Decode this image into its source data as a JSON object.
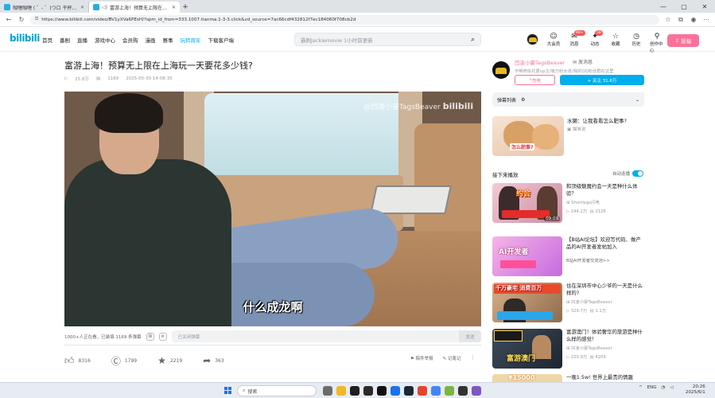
{
  "browser": {
    "tabs": [
      {
        "label": "咖喱咖喱 ( ゜- ゜)つロ 干杯~-bilibili",
        "active": false
      },
      {
        "label": "富游上海！预算无上限在上海...",
        "active": true
      }
    ],
    "new_tab": "+",
    "window_controls": {
      "minimize": "—",
      "maximize": "▢",
      "close": "✕"
    },
    "url": "https://www.bilibili.com/video/BV1yXVa6PEsH/?spm_id_from=333.1007.tianma.1-3-3.click&vd_source=7ac66cdf432812f7ec184060f708cb2d"
  },
  "site_header": {
    "logo": "bilibili",
    "nav": [
      "首页",
      "番剧",
      "直播",
      "游戏中心",
      "会员购",
      "漫画",
      "赛事",
      "玩转周年",
      "下载客户端"
    ],
    "search_placeholder": "霸刷Jackiemovie 1小时前更新",
    "user_icons": [
      {
        "label": "大会员",
        "glyph": "☺",
        "badge": ""
      },
      {
        "label": "消息",
        "glyph": "✉",
        "badge": "99+"
      },
      {
        "label": "动态",
        "glyph": "✦",
        "badge": "58"
      },
      {
        "label": "收藏",
        "glyph": "☆",
        "badge": ""
      },
      {
        "label": "历史",
        "glyph": "◷",
        "badge": ""
      },
      {
        "label": "创作中心",
        "glyph": "⚲",
        "badge": ""
      }
    ],
    "upload_label": "投稿"
  },
  "video": {
    "title": "富游上海！预算无上限在上海玩一天要花多少钱?",
    "views": "25.8万",
    "danmaku": "1169",
    "date": "2025-05-30 14:08:35",
    "watermark": "@凹凌小豪TagsBeaver",
    "watermark_logo": "bilibili",
    "subtitle": "什么成龙啊",
    "live_count": "1000+人正在看，已装填 1169 条弹幕",
    "danmaku_placeholder": "已关闭弹幕",
    "send_label": "发送"
  },
  "toolbar": {
    "like": "8316",
    "coin": "1799",
    "favorite": "2219",
    "share": "363",
    "report": "稿件举报",
    "notes": "记笔记",
    "more": "⋮"
  },
  "uploader": {
    "name": "凹凌小豪TagsBeaver",
    "message": "发消息",
    "desc": "不带商侩托更up主/吸万粉女孩/我的QQ粉丝群在这里",
    "charge": "充电",
    "follow": "+ 关注 31.6万"
  },
  "danmu_list": {
    "label": "弹幕列表",
    "settings": "⚙",
    "expand": "⌄"
  },
  "ad": {
    "title": "水獭：让我看看怎么肥事?",
    "caption": "怎么肥事?",
    "source": "猫咪说"
  },
  "next_up": {
    "label": "接下来播放",
    "autoplay": "自动连播"
  },
  "recommendations": [
    {
      "title": "和顶级魅魔约会一天是种什么体验？",
      "author": "Shortlegs闪电",
      "plays": "144.2万",
      "danmaku": "2126",
      "duration": "09:09",
      "caption": "约会"
    },
    {
      "title": "【B站AI论坛】欢迎写代码、做产品的AI开发者发帖加入",
      "author": "",
      "plays": "",
      "danmaku": "",
      "duration": "",
      "caption": "AI开发者",
      "subline": "B站AI开发者交流池>>"
    },
    {
      "title": "住在深圳市中心少爷的一天是什么样的?",
      "author": "凹凌小豪TagsBeaver",
      "plays": "329.7万",
      "danmaku": "1.1万",
      "duration": "",
      "caption": "千万豪宅 消费百万"
    },
    {
      "title": "富游澳门！体验奢华的旅游是种什么样的感觉！",
      "author": "凹凌小豪TagsBeaver",
      "plays": "220.9万",
      "danmaku": "4209",
      "duration": "",
      "caption": "富游澳门"
    },
    {
      "title": "一晚1.5w! 世界上最贵的情趣",
      "author": "",
      "plays": "",
      "danmaku": "",
      "duration": "",
      "caption": "¥15000"
    }
  ],
  "taskbar": {
    "search": "搜索",
    "lang": "ENG",
    "time": "20:26",
    "date": "2025/6/1"
  },
  "colors": {
    "brand": "#00aeec",
    "pink": "#fb7299"
  }
}
